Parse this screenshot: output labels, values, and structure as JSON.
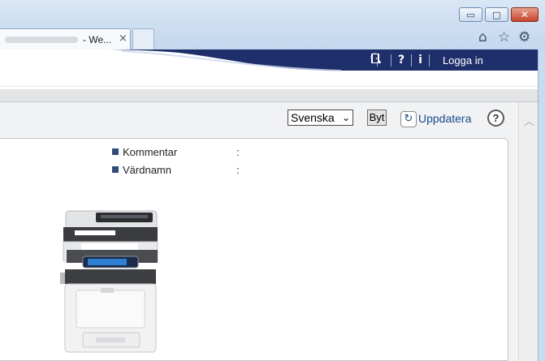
{
  "browser": {
    "tab_title": "- We...",
    "tab_close": "×",
    "window_controls": {
      "minimize": "▭",
      "maximize": "□",
      "close": "✕"
    },
    "toolbar_icons": [
      "home-icon",
      "star-icon",
      "gear-icon"
    ]
  },
  "header": {
    "search_icon": "search-icon",
    "help_mark": "?",
    "info_mark": "i",
    "login_label": "Logga in"
  },
  "controls": {
    "language_selected": "Svenska",
    "change_button": "Byt",
    "refresh_label": "Uppdatera",
    "help_mark": "?"
  },
  "device_info": {
    "rows": [
      {
        "label": "Kommentar",
        "separator": ":"
      },
      {
        "label": "Värdnamn",
        "separator": ":"
      }
    ]
  },
  "colors": {
    "header_band": "#1f2f6b",
    "bullet": "#2f4c7a",
    "link": "#1a4a8c"
  }
}
